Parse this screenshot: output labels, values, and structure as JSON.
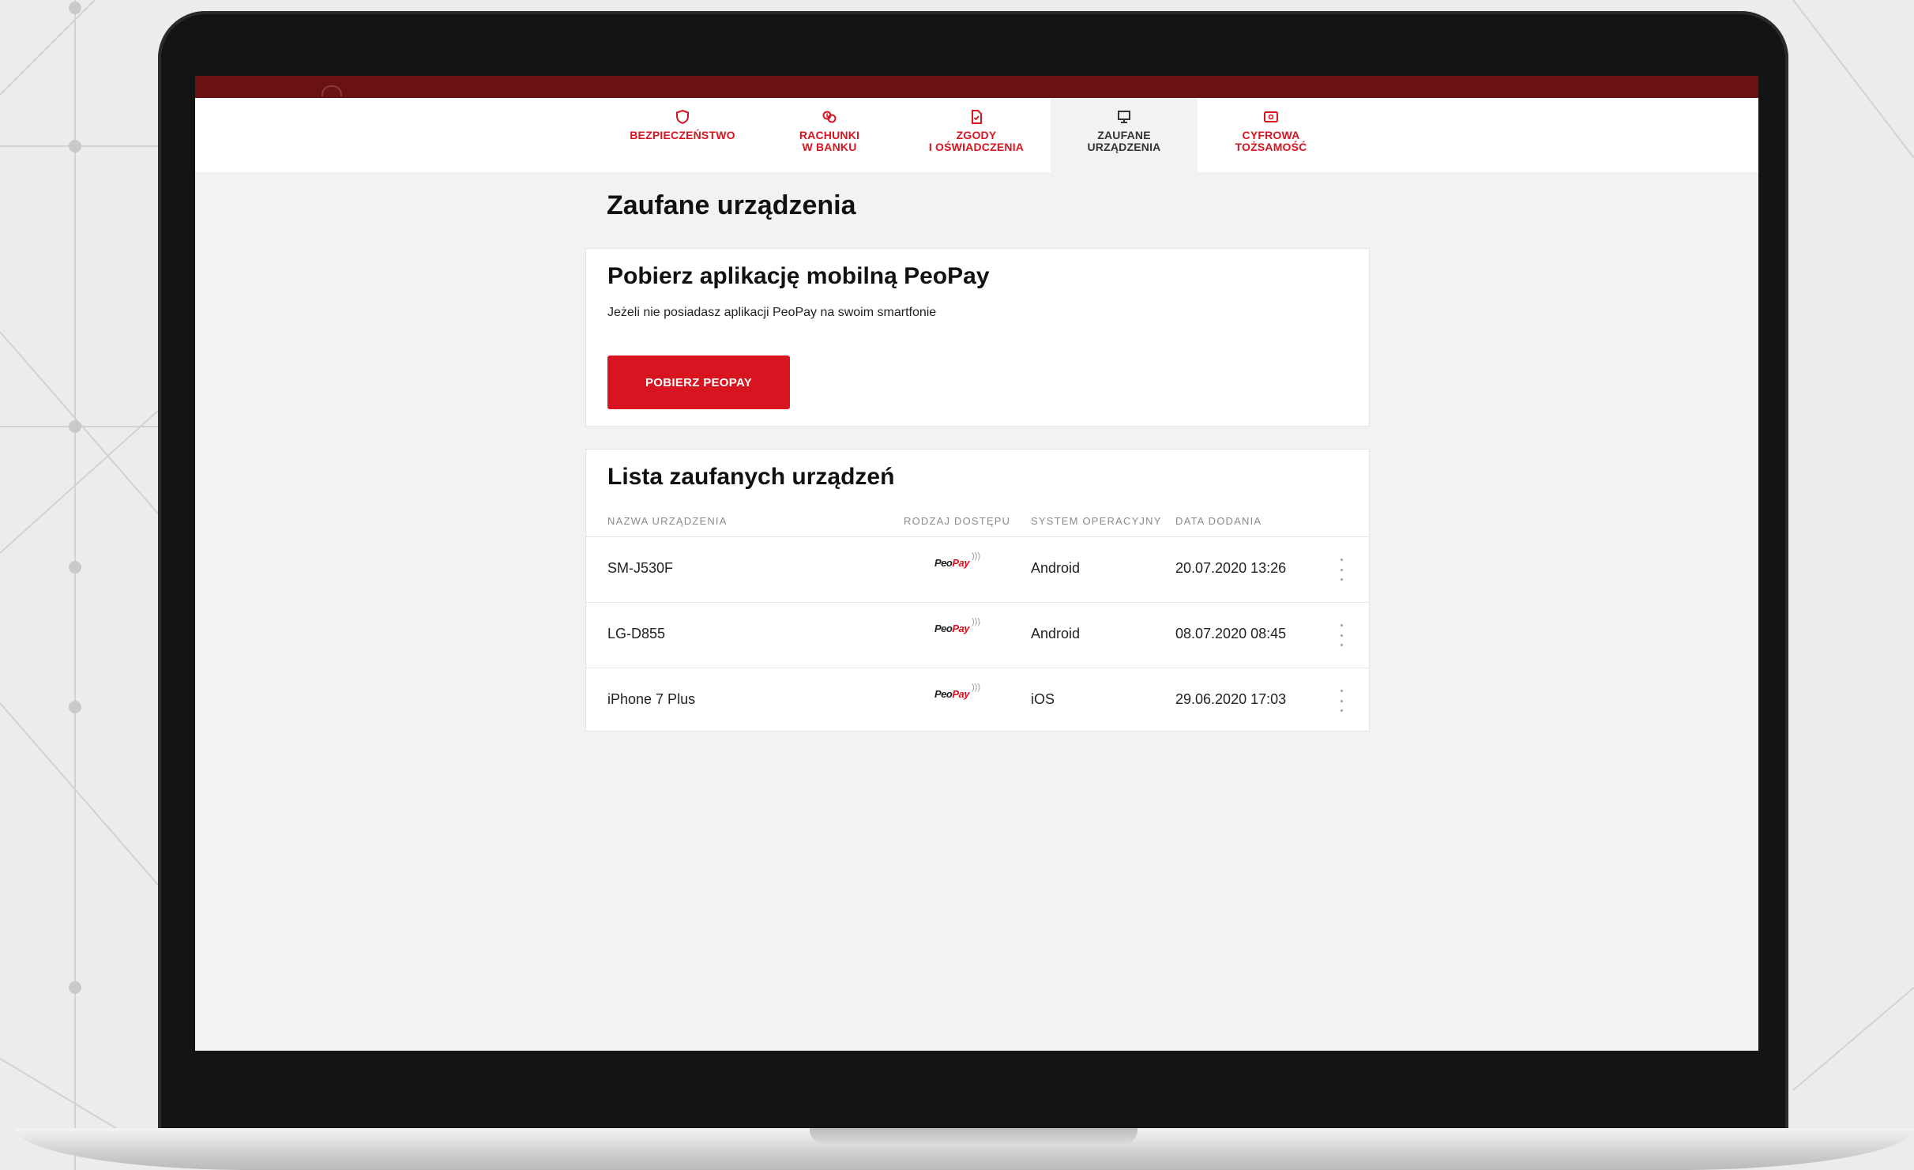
{
  "nav": {
    "tabs": [
      {
        "label": "BEZPIECZEŃSTWO",
        "icon": "shield-icon",
        "active": false
      },
      {
        "label": "RACHUNKI\nW BANKU",
        "icon": "bank-accounts-icon",
        "active": false
      },
      {
        "label": "ZGODY\nI OŚWIADCZENIA",
        "icon": "document-icon",
        "active": false
      },
      {
        "label": "ZAUFANE\nURZĄDZENIA",
        "icon": "monitor-icon",
        "active": true
      },
      {
        "label": "CYFROWA\nTOŻSAMOŚĆ",
        "icon": "id-card-icon",
        "active": false
      }
    ]
  },
  "page": {
    "title": "Zaufane urządzenia"
  },
  "promo": {
    "title": "Pobierz aplikację mobilną PeoPay",
    "description": "Jeżeli nie posiadasz aplikacji PeoPay na swoim smartfonie",
    "button_label": "POBIERZ PEOPAY"
  },
  "devices": {
    "title": "Lista zaufanych urządzeń",
    "columns": [
      "NAZWA URZĄDZENIA",
      "RODZAJ DOSTĘPU",
      "SYSTEM OPERACYJNY",
      "DATA DODANIA"
    ],
    "access_logo": {
      "left": "Peo",
      "right": "Pay"
    },
    "rows": [
      {
        "name": "SM-J530F",
        "access": "PeoPay",
        "os": "Android",
        "date": "20.07.2020 13:26"
      },
      {
        "name": "LG-D855",
        "access": "PeoPay",
        "os": "Android",
        "date": "08.07.2020 08:45"
      },
      {
        "name": "iPhone 7 Plus",
        "access": "PeoPay",
        "os": "iOS",
        "date": "29.06.2020 17:03"
      }
    ]
  },
  "colors": {
    "brand_red": "#d7141f",
    "top_bar": "#6a1212",
    "page_bg": "#f2f2f2"
  }
}
